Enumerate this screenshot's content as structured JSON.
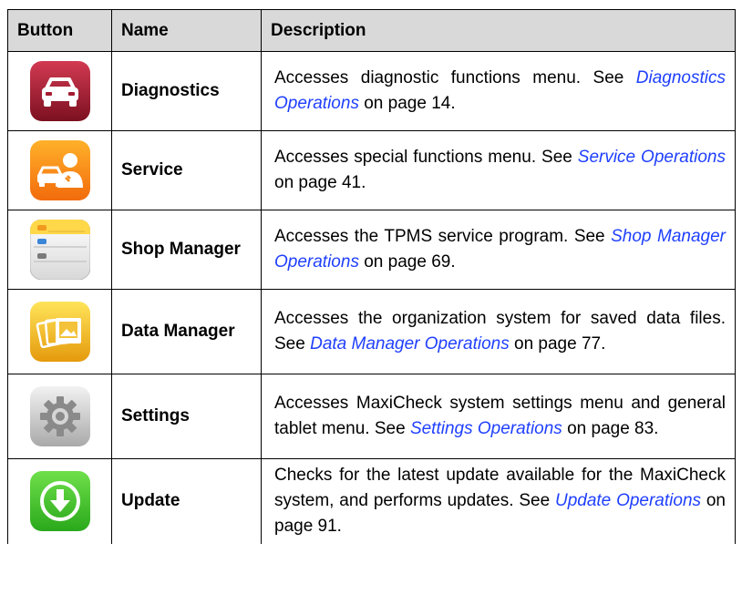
{
  "headers": {
    "button": "Button",
    "name": "Name",
    "description": "Description"
  },
  "rows": [
    {
      "name": "Diagnostics",
      "desc_pre": "Accesses diagnostic functions menu. See ",
      "link": "Diagnostics Operations",
      "desc_post": " on page 14.",
      "icon": "car-icon"
    },
    {
      "name": "Service",
      "desc_pre": "Accesses special functions menu. See ",
      "link": "Service Operations",
      "desc_post": " on page 41.",
      "icon": "car-service-person-icon"
    },
    {
      "name": "Shop Manager",
      "desc_pre": "Accesses the TPMS service program. See ",
      "link": "Shop Manager Operations",
      "desc_post": " on page 69.",
      "icon": "car-list-icon"
    },
    {
      "name": "Data Manager",
      "desc_pre": "Accesses the organization system for saved data files. See ",
      "link": "Data Manager Operations",
      "desc_post": " on page 77.",
      "icon": "photo-files-icon"
    },
    {
      "name": "Settings",
      "desc_pre": "Accesses MaxiCheck system settings menu and general tablet menu. See ",
      "link": "Settings Operations",
      "desc_post": " on page 83.",
      "icon": "gear-icon"
    },
    {
      "name": "Update",
      "desc_pre": "Checks for the latest update available for the MaxiCheck system, and performs updates. See ",
      "link": "Update Operations",
      "desc_post": " on page 91.",
      "icon": "download-arrow-icon"
    }
  ],
  "colors": {
    "header_bg": "#d9d9d9",
    "link": "#1f3fff"
  }
}
